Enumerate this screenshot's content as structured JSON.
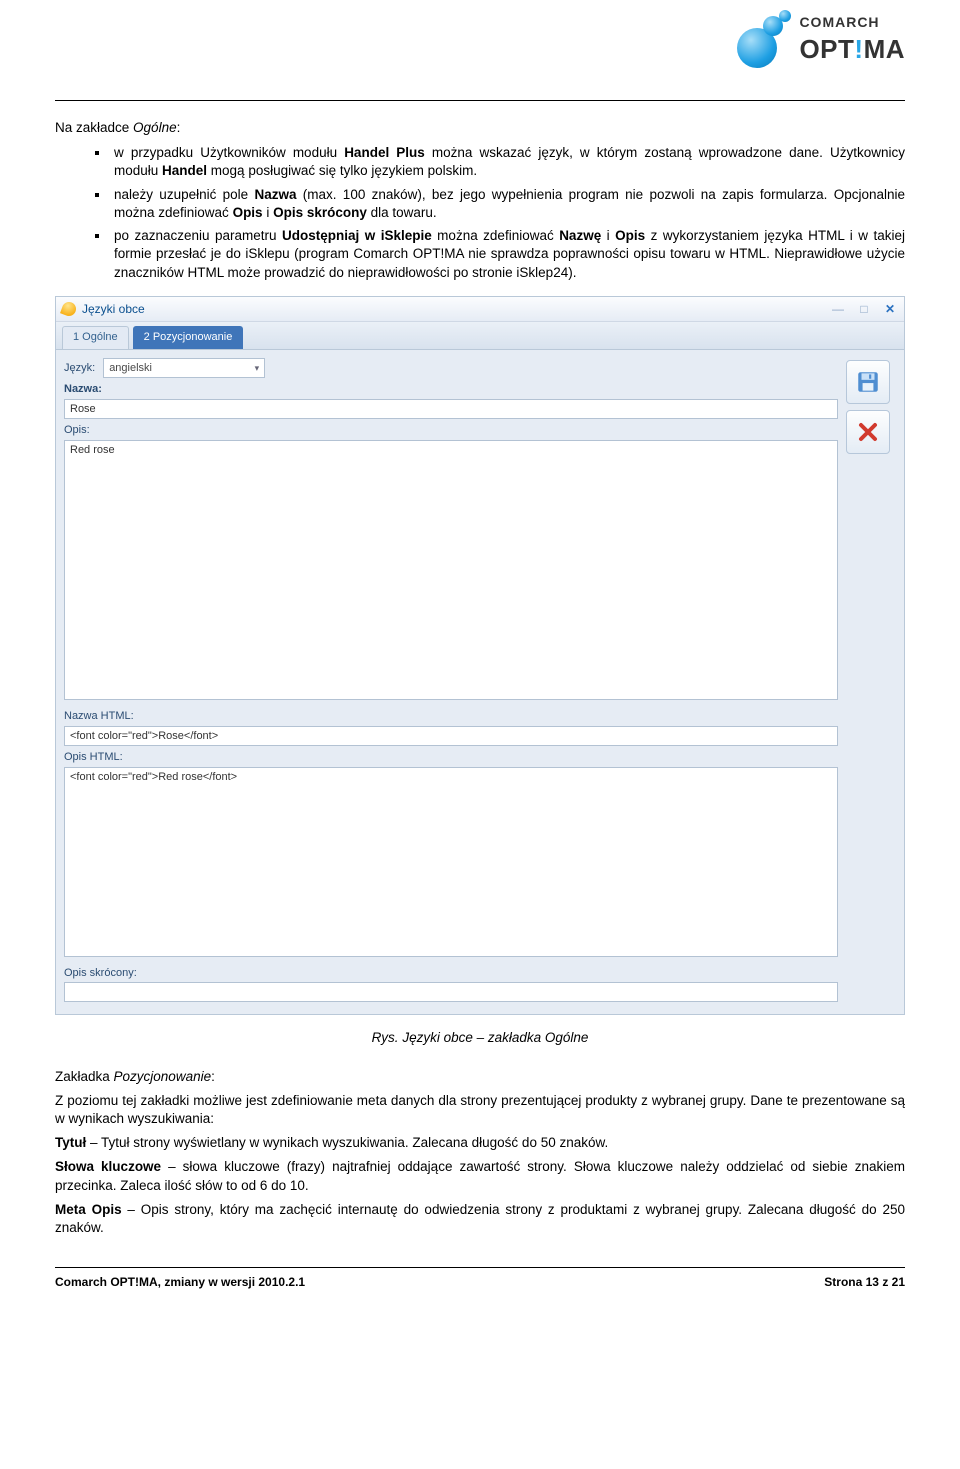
{
  "header": {
    "company": "COMARCH",
    "product": "OPT!MA"
  },
  "intro": {
    "lead_prefix": "Na zakładce ",
    "lead_italic": "Ogólne",
    "lead_suffix": ":"
  },
  "bullets": {
    "b1_p1": "w przypadku Użytkowników modułu ",
    "b1_b1": "Handel Plus",
    "b1_p2": " można wskazać język, w którym zostaną wprowadzone dane. Użytkownicy modułu ",
    "b1_b2": "Handel",
    "b1_p3": " mogą posługiwać się tylko językiem polskim.",
    "b2_p1": "należy uzupełnić pole ",
    "b2_b1": "Nazwa",
    "b2_p2": " (max. 100 znaków), bez jego wypełnienia program nie pozwoli na zapis formularza. Opcjonalnie można zdefiniować ",
    "b2_b2": "Opis",
    "b2_p3": " i ",
    "b2_b3": "Opis skrócony",
    "b2_p4": " dla towaru.",
    "b3_p1": "po zaznaczeniu parametru ",
    "b3_b1": "Udostępniaj w iSklepie",
    "b3_p2": " można zdefiniować ",
    "b3_b2": "Nazwę",
    "b3_p3": " i ",
    "b3_b3": "Opis",
    "b3_p4": " z wykorzystaniem języka HTML i w takiej formie przesłać je do iSklepu (program Comarch OPT!MA nie sprawdza poprawności opisu towaru w HTML. Nieprawidłowe użycie znaczników HTML może prowadzić do nieprawidłowości po stronie iSklep24)."
  },
  "window": {
    "title": "Języki obce",
    "tabs": {
      "t1": "1 Ogólne",
      "t2": "2 Pozycjonowanie"
    },
    "labels": {
      "jezyk": "Język:",
      "nazwa": "Nazwa:",
      "opis": "Opis:",
      "nazwa_html": "Nazwa HTML:",
      "opis_html": "Opis HTML:",
      "opis_skr": "Opis skrócony:"
    },
    "values": {
      "jezyk": "angielski",
      "nazwa": "Rose",
      "opis": "Red rose",
      "nazwa_html": "<font color=\"red\">Rose</font>",
      "opis_html": "<font color=\"red\">Red rose</font>",
      "opis_skr": ""
    }
  },
  "caption": "Rys. Języki obce – zakładka Ogólne",
  "section2": {
    "lead_prefix": "Zakładka ",
    "lead_italic": "Pozycjonowanie",
    "lead_suffix": ":",
    "p1": "Z poziomu tej zakładki możliwe jest zdefiniowanie meta danych dla strony prezentującej produkty z wybranej grupy. Dane te prezentowane są w wynikach wyszukiwania:",
    "p2_b": "Tytuł",
    "p2_t": " – Tytuł strony wyświetlany w wynikach wyszukiwania. Zalecana długość do 50 znaków.",
    "p3_b": "Słowa kluczowe",
    "p3_t": " – słowa kluczowe (frazy) najtrafniej oddające zawartość strony. Słowa kluczowe należy oddzielać od siebie znakiem przecinka. Zaleca ilość słów to od 6 do 10.",
    "p4_b": "Meta Opis",
    "p4_t": " – Opis strony, który ma zachęcić internautę do odwiedzenia strony z produktami z wybranej grupy. Zalecana długość do 250 znaków."
  },
  "footer": {
    "left": "Comarch OPT!MA, zmiany w wersji 2010.2.1",
    "right": "Strona 13 z 21"
  }
}
